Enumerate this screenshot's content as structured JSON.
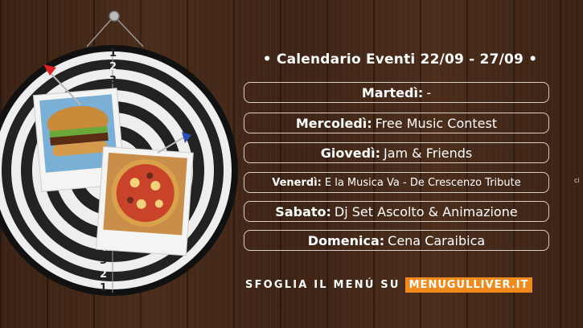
{
  "header": "• Calendario Eventi 22/09 - 27/09 •",
  "events": [
    {
      "day": "Martedì:",
      "event": "-"
    },
    {
      "day": "Mercoledì:",
      "event": "Free Music Contest"
    },
    {
      "day": "Giovedì:",
      "event": "Jam & Friends"
    },
    {
      "day": "Venerdì:",
      "event": "E la Musica Va - De Crescenzo Tribute"
    },
    {
      "day": "Sabato:",
      "event": "Dj Set Ascolto & Animazione"
    },
    {
      "day": "Domenica:",
      "event": "Cena Caraibica"
    }
  ],
  "footer": {
    "text": "SFOGLIA IL MENÚ SU",
    "link": "MENUGULLIVER.IT"
  },
  "dartboard_numbers_top": [
    "1",
    "2",
    "3"
  ],
  "dartboard_numbers_bottom": [
    "4",
    "3",
    "2",
    "1"
  ],
  "edge_text": "ci",
  "colors": {
    "accent": "#f08a1c",
    "wood": "#3e2416",
    "border": "#d9cfc7"
  }
}
